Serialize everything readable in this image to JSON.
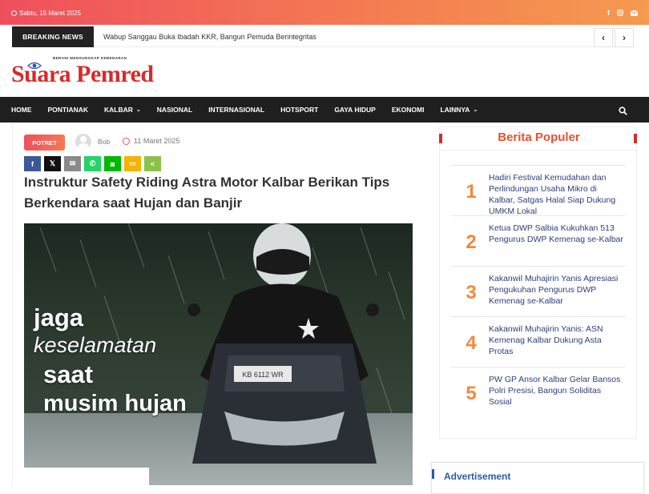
{
  "topbar": {
    "date": "Sabtu, 15 Maret 2025",
    "social": [
      "facebook-icon",
      "instagram-icon",
      "email-icon"
    ]
  },
  "breaking": {
    "label": "BREAKING NEWS",
    "headline": "Wabup Sanggau Buka Ibadah KKR, Bangun Pemuda Berintegritas",
    "prev": "‹",
    "next": "›"
  },
  "logo": {
    "tagline": "BERANI MENGUNGKAP KEBENARAN",
    "name": "Suara Pemred"
  },
  "nav": {
    "items": [
      {
        "label": "HOME"
      },
      {
        "label": "PONTIANAK"
      },
      {
        "label": "KALBAR",
        "dropdown": "⌄"
      },
      {
        "label": "NASIONAL"
      },
      {
        "label": "INTERNASIONAL"
      },
      {
        "label": "HOTSPORT"
      },
      {
        "label": "GAYA HIDUP"
      },
      {
        "label": "EKONOMI"
      },
      {
        "label": "LAINNYA",
        "dropdown": "⌄"
      }
    ]
  },
  "article": {
    "category": "POTRET",
    "author": "Bob",
    "date": "11 Maret 2025",
    "share": [
      {
        "icon": "facebook-icon",
        "glyph": "f",
        "color": "#3b5998"
      },
      {
        "icon": "x-icon",
        "glyph": "𝕏",
        "color": "#111111"
      },
      {
        "icon": "email-icon",
        "glyph": "✉",
        "color": "#8a8a8a"
      },
      {
        "icon": "whatsapp-icon",
        "glyph": "✆",
        "color": "#25d366"
      },
      {
        "icon": "line-icon",
        "glyph": "◙",
        "color": "#00b900"
      },
      {
        "icon": "sms-icon",
        "glyph": "▭",
        "color": "#f4b400"
      },
      {
        "icon": "share-icon",
        "glyph": "<",
        "color": "#8bc34a"
      }
    ],
    "title": "Instruktur Safety Riding Astra Motor Kalbar Berikan Tips Berkendara saat Hujan dan Banjir",
    "image_text": {
      "line1": "jaga",
      "line2": "keselamatan",
      "line3": "saat",
      "line4": "musim hujan",
      "plate": "KB 6112 WR"
    }
  },
  "sidebar": {
    "heading": "Berita Populer",
    "items": [
      {
        "num": "1",
        "title": "Hadiri Festival Kemudahan dan Perlindungan Usaha Mikro di Kalbar, Satgas Halal Siap Dukung UMKM Lokal"
      },
      {
        "num": "2",
        "title": "Ketua DWP Salbia Kukuhkan 513 Pengurus DWP Kemenag se-Kalbar"
      },
      {
        "num": "3",
        "title": "Kakanwil Muhajirin Yanis Apresiasi Pengukuhan Pengurus DWP Kemenag se-Kalbar"
      },
      {
        "num": "4",
        "title": "Kakanwil Muhajirin Yanis: ASN Kemenag Kalbar Dukung Asta Protas"
      },
      {
        "num": "5",
        "title": "PW GP Ansor Kalbar Gelar Bansos Polri Presisi, Bangun Soliditas Sosial"
      }
    ]
  },
  "advertisement": {
    "label": "Advertisement"
  },
  "colors": {
    "accent": "#ef4f5d",
    "brand_red": "#d72b2b",
    "nav_bg": "#1f1f1f",
    "popular_number": "#f08a3c",
    "link_blue": "#2c3e7a"
  }
}
